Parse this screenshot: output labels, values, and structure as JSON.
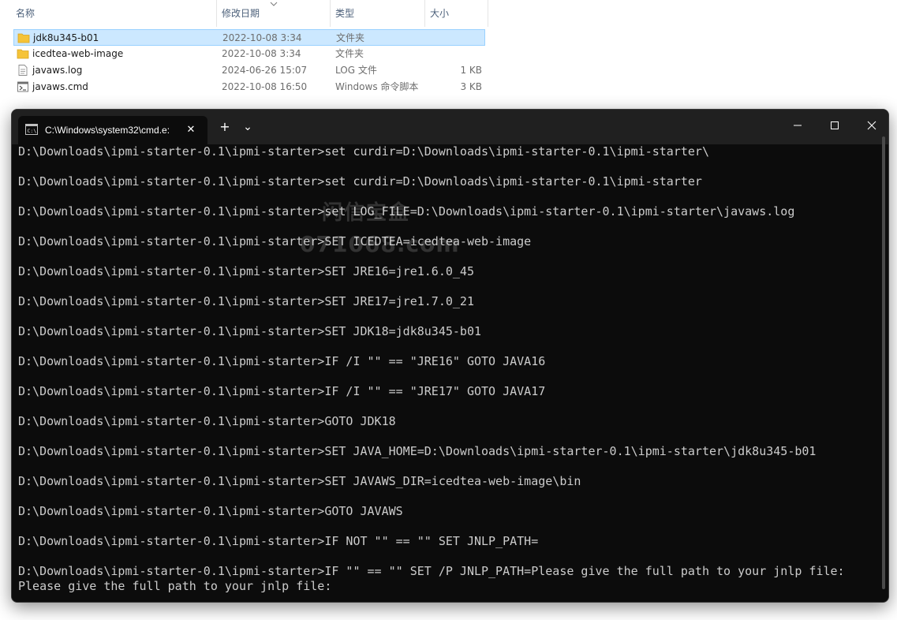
{
  "explorer": {
    "columns": {
      "name": "名称",
      "date": "修改日期",
      "type": "类型",
      "size": "大小"
    },
    "rows": [
      {
        "name": "jdk8u345-b01",
        "date": "2022-10-08 3:34",
        "type": "文件夹",
        "size": "",
        "icon": "folder-icon",
        "selected": true
      },
      {
        "name": "icedtea-web-image",
        "date": "2022-10-08 3:34",
        "type": "文件夹",
        "size": "",
        "icon": "folder-icon",
        "selected": false
      },
      {
        "name": "javaws.log",
        "date": "2024-06-26 15:07",
        "type": "LOG 文件",
        "size": "1 KB",
        "icon": "text-file-icon",
        "selected": false
      },
      {
        "name": "javaws.cmd",
        "date": "2022-10-08 16:50",
        "type": "Windows 命令脚本",
        "size": "3 KB",
        "icon": "script-file-icon",
        "selected": false
      }
    ],
    "colors": {
      "folder": "#f5c338",
      "selection": "#cce8ff"
    }
  },
  "terminal": {
    "tab_title": "C:\\Windows\\system32\\cmd.e:",
    "tab_close": "✕",
    "new_tab": "+",
    "tab_menu": "⌄",
    "lines": [
      "D:\\Downloads\\ipmi-starter-0.1\\ipmi-starter>set curdir=D:\\Downloads\\ipmi-starter-0.1\\ipmi-starter\\",
      "",
      "D:\\Downloads\\ipmi-starter-0.1\\ipmi-starter>set curdir=D:\\Downloads\\ipmi-starter-0.1\\ipmi-starter",
      "",
      "D:\\Downloads\\ipmi-starter-0.1\\ipmi-starter>set LOG_FILE=D:\\Downloads\\ipmi-starter-0.1\\ipmi-starter\\javaws.log",
      "",
      "D:\\Downloads\\ipmi-starter-0.1\\ipmi-starter>SET ICEDTEA=icedtea-web-image",
      "",
      "D:\\Downloads\\ipmi-starter-0.1\\ipmi-starter>SET JRE16=jre1.6.0_45",
      "",
      "D:\\Downloads\\ipmi-starter-0.1\\ipmi-starter>SET JRE17=jre1.7.0_21",
      "",
      "D:\\Downloads\\ipmi-starter-0.1\\ipmi-starter>SET JDK18=jdk8u345-b01",
      "",
      "D:\\Downloads\\ipmi-starter-0.1\\ipmi-starter>IF /I \"\" == \"JRE16\" GOTO JAVA16",
      "",
      "D:\\Downloads\\ipmi-starter-0.1\\ipmi-starter>IF /I \"\" == \"JRE17\" GOTO JAVA17",
      "",
      "D:\\Downloads\\ipmi-starter-0.1\\ipmi-starter>GOTO JDK18",
      "",
      "D:\\Downloads\\ipmi-starter-0.1\\ipmi-starter>SET JAVA_HOME=D:\\Downloads\\ipmi-starter-0.1\\ipmi-starter\\jdk8u345-b01",
      "",
      "D:\\Downloads\\ipmi-starter-0.1\\ipmi-starter>SET JAVAWS_DIR=icedtea-web-image\\bin",
      "",
      "D:\\Downloads\\ipmi-starter-0.1\\ipmi-starter>GOTO JAVAWS",
      "",
      "D:\\Downloads\\ipmi-starter-0.1\\ipmi-starter>IF NOT \"\" == \"\" SET JNLP_PATH=",
      "",
      "D:\\Downloads\\ipmi-starter-0.1\\ipmi-starter>IF \"\" == \"\" SET /P JNLP_PATH=Please give the full path to your jnlp file:",
      "Please give the full path to your jnlp file:"
    ],
    "colors": {
      "background": "#0c0c0c",
      "text": "#cccccc",
      "titlebar": "#202020"
    }
  },
  "watermark": {
    "line1": "闪信宝盒",
    "line2": "071068.com"
  }
}
